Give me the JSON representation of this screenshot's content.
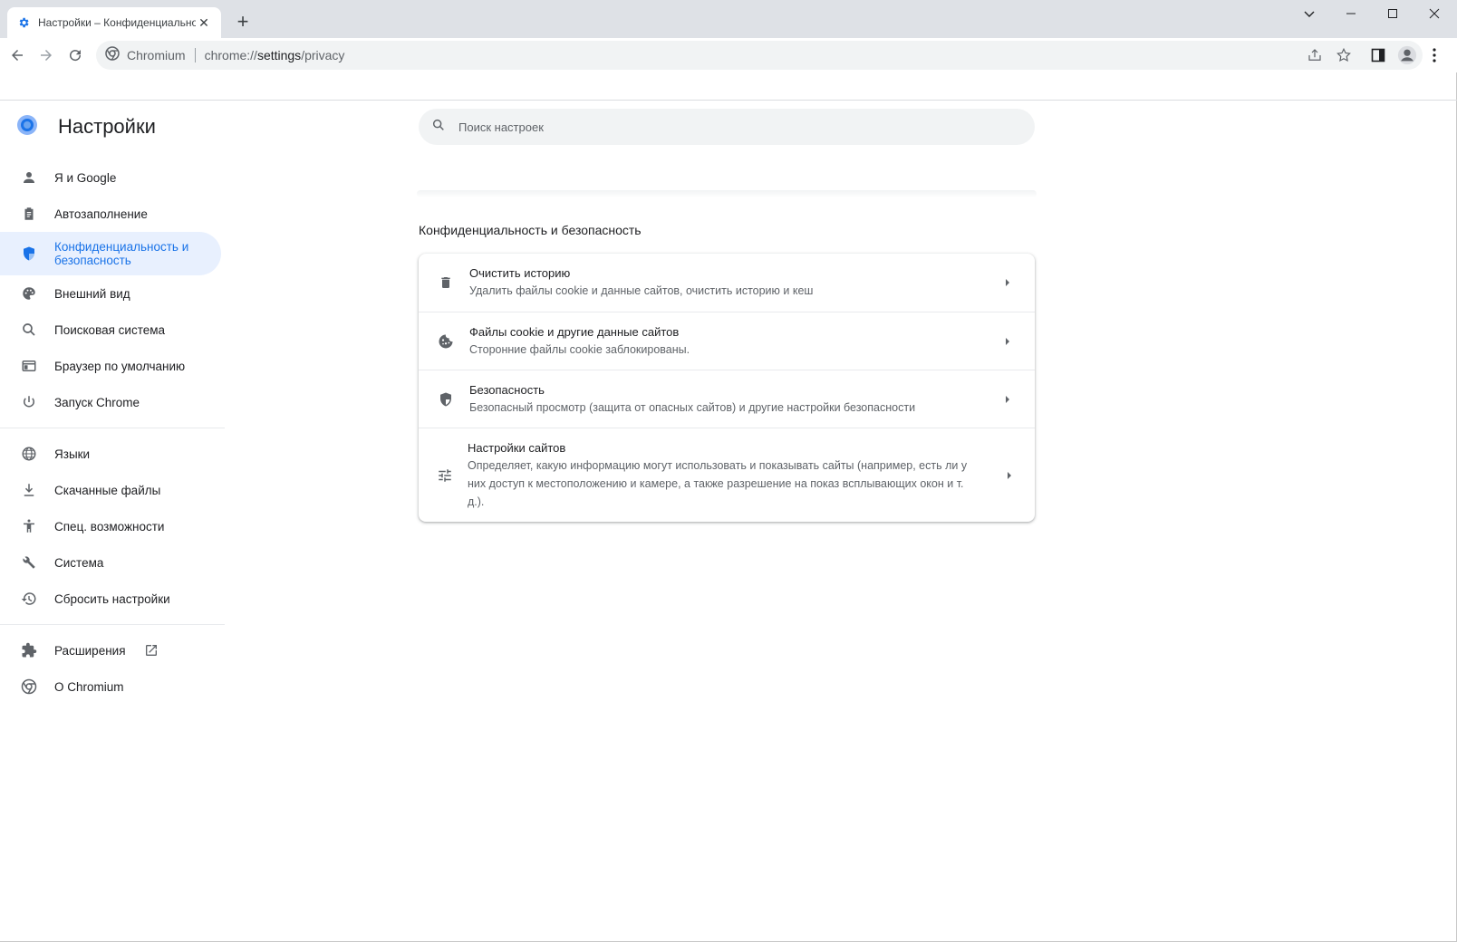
{
  "tab": {
    "title": "Настройки – Конфиденциальность",
    "close_glyph": "✕",
    "new_tab_glyph": "+"
  },
  "omnibox": {
    "site": "Chromium",
    "url_prefix": "chrome://",
    "url_path": "settings",
    "url_suffix": "/privacy"
  },
  "header": {
    "title": "Настройки"
  },
  "search": {
    "placeholder": "Поиск настроек"
  },
  "sidebar": {
    "items": [
      {
        "label": "Я и Google"
      },
      {
        "label": "Автозаполнение"
      },
      {
        "label": "Конфиденциальность и безопасность"
      },
      {
        "label": "Внешний вид"
      },
      {
        "label": "Поисковая система"
      },
      {
        "label": "Браузер по умолчанию"
      },
      {
        "label": "Запуск Chrome"
      },
      {
        "label": "Языки"
      },
      {
        "label": "Скачанные файлы"
      },
      {
        "label": "Спец. возможности"
      },
      {
        "label": "Система"
      },
      {
        "label": "Сбросить настройки"
      },
      {
        "label": "Расширения"
      },
      {
        "label": "О Chromium"
      }
    ]
  },
  "main": {
    "section_title": "Конфиденциальность и безопасность",
    "rows": [
      {
        "title": "Очистить историю",
        "subtitle": "Удалить файлы cookie и данные сайтов, очистить историю и кеш"
      },
      {
        "title": "Файлы cookie и другие данные сайтов",
        "subtitle": "Сторонние файлы cookie заблокированы."
      },
      {
        "title": "Безопасность",
        "subtitle": "Безопасный просмотр (защита от опасных сайтов) и другие настройки безопасности"
      },
      {
        "title": "Настройки сайтов",
        "subtitle": "Определяет, какую информацию могут использовать и показывать сайты (например, есть ли у них доступ к местоположению и камере, а также разрешение на показ всплывающих окон и т. д.)."
      }
    ]
  },
  "colors": {
    "accent": "#1a73e8",
    "active_bg": "#e8f0fe",
    "tabstrip": "#dee1e6"
  }
}
